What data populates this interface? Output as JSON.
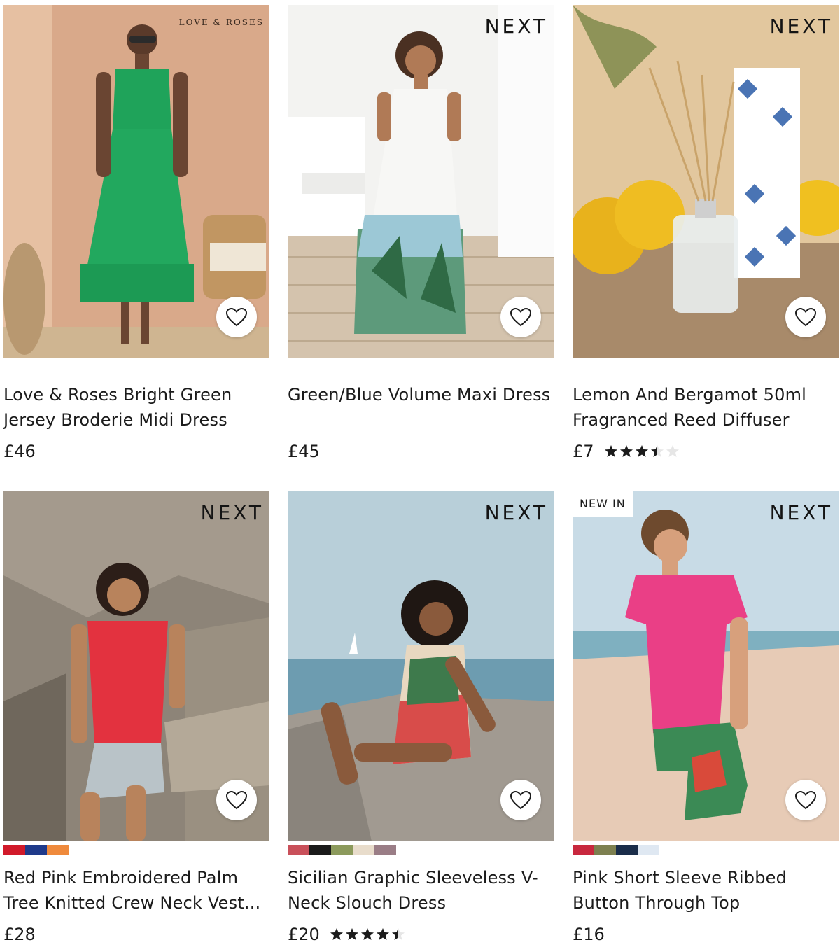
{
  "products": [
    {
      "brand": "LOVE & ROSES",
      "title": "Love & Roses Bright Green Jersey Broderie Midi Dress",
      "price": "£46",
      "rating": null,
      "badge": null,
      "swatches": []
    },
    {
      "brand": "NEXT",
      "title": "Green/Blue Volume Maxi Dress",
      "price": "£45",
      "rating": null,
      "badge": null,
      "swatches": []
    },
    {
      "brand": "NEXT",
      "title": "Lemon And Bergamot 50ml Fragranced Reed Diffuser",
      "price": "£7",
      "rating": 3.5,
      "badge": null,
      "swatches": []
    },
    {
      "brand": "NEXT",
      "title": "Red Pink Embroidered Palm Tree Knitted Crew Neck Vest...",
      "price": "£28",
      "rating": null,
      "badge": null,
      "swatches": [
        "#d11a2a",
        "#1f3a8a",
        "#ef8a3c"
      ]
    },
    {
      "brand": "NEXT",
      "title": "Sicilian Graphic Sleeveless V-Neck Slouch Dress",
      "price": "£20",
      "rating": 4.5,
      "badge": null,
      "swatches": [
        "#c9505a",
        "#1b1b1b",
        "#8c9a5c",
        "#e8dccb",
        "#9a7d86"
      ]
    },
    {
      "brand": "NEXT",
      "title": "Pink Short Sleeve Ribbed Button Through Top",
      "price": "£16",
      "rating": null,
      "badge": "NEW IN",
      "swatches": [
        "#c8283e",
        "#7d8050",
        "#1a2d4a",
        "#dfe8f2"
      ]
    }
  ],
  "icons": {
    "favourite": "heart-outline-icon",
    "rating": "star-icon"
  },
  "colors": {
    "text": "#1b1b1b",
    "star": "#1b1b1b",
    "star_empty": "#e6e6e6"
  }
}
